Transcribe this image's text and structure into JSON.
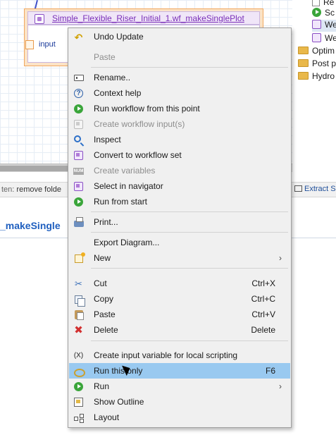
{
  "canvas": {
    "node_title": "Simple_Flexible_Riser_Initial_1.wf_makeSinglePlot",
    "port_label": "input"
  },
  "status": {
    "prefix": "ten:",
    "text": "remove folde"
  },
  "extract_label": "Extract S",
  "editor_tab": "_makeSingle",
  "tree": {
    "items": [
      {
        "label": "Re",
        "icon": "doc-icon"
      },
      {
        "label": "Sc",
        "icon": "run-icon"
      },
      {
        "label": "We",
        "icon": "workflow-icon"
      },
      {
        "label": "We",
        "icon": "workflow-icon"
      },
      {
        "label": "Optim",
        "icon": "folder-icon"
      },
      {
        "label": "Post p",
        "icon": "folder-icon"
      },
      {
        "label": "Hydro",
        "icon": "folder-icon"
      }
    ]
  },
  "menu": {
    "items": [
      {
        "label": "Undo Update",
        "icon": "undo-icon",
        "enabled": true
      },
      {
        "label": "Paste",
        "icon": "",
        "enabled": false
      },
      {
        "label": "Rename..",
        "icon": "rename-icon",
        "enabled": true
      },
      {
        "label": "Context help",
        "icon": "help-icon",
        "enabled": true
      },
      {
        "label": "Run workflow from this point",
        "icon": "run-icon",
        "enabled": true
      },
      {
        "label": "Create workflow input(s)",
        "icon": "workflow-input-icon",
        "enabled": false
      },
      {
        "label": "Inspect",
        "icon": "search-icon",
        "enabled": true
      },
      {
        "label": "Convert to workflow set",
        "icon": "workflow-icon",
        "enabled": true
      },
      {
        "label": "Create variables",
        "icon": "num-icon",
        "enabled": false
      },
      {
        "label": "Select in navigator",
        "icon": "workflow-icon",
        "enabled": true
      },
      {
        "label": "Run from start",
        "icon": "run-icon",
        "enabled": true
      },
      {
        "label": "Print...",
        "icon": "print-icon",
        "enabled": true
      },
      {
        "label": "Export Diagram...",
        "icon": "",
        "enabled": true
      },
      {
        "label": "New",
        "icon": "new-icon",
        "enabled": true,
        "submenu": true
      },
      {
        "label": "Cut",
        "icon": "cut-icon",
        "enabled": true,
        "shortcut": "Ctrl+X"
      },
      {
        "label": "Copy",
        "icon": "copy-icon",
        "enabled": true,
        "shortcut": "Ctrl+C"
      },
      {
        "label": "Paste",
        "icon": "paste-icon",
        "enabled": true,
        "shortcut": "Ctrl+V"
      },
      {
        "label": "Delete",
        "icon": "delete-icon",
        "enabled": true,
        "shortcut": "Delete"
      },
      {
        "label": "Create input variable for local scripting",
        "icon": "variable-icon",
        "icon_text": "(X)",
        "enabled": true
      },
      {
        "label": "Run this only",
        "icon": "run-this-icon",
        "enabled": true,
        "shortcut": "F6",
        "highlighted": true
      },
      {
        "label": "Run",
        "icon": "run-icon",
        "enabled": true,
        "submenu": true
      },
      {
        "label": "Show Outline",
        "icon": "outline-icon",
        "enabled": true
      },
      {
        "label": "Layout",
        "icon": "layout-icon",
        "enabled": true
      }
    ]
  },
  "colors": {
    "menu_background": "#f0f0f0",
    "highlight": "#99c9f0",
    "disabled_text": "#8d8d8d",
    "node_title": "#7a2fb8"
  }
}
